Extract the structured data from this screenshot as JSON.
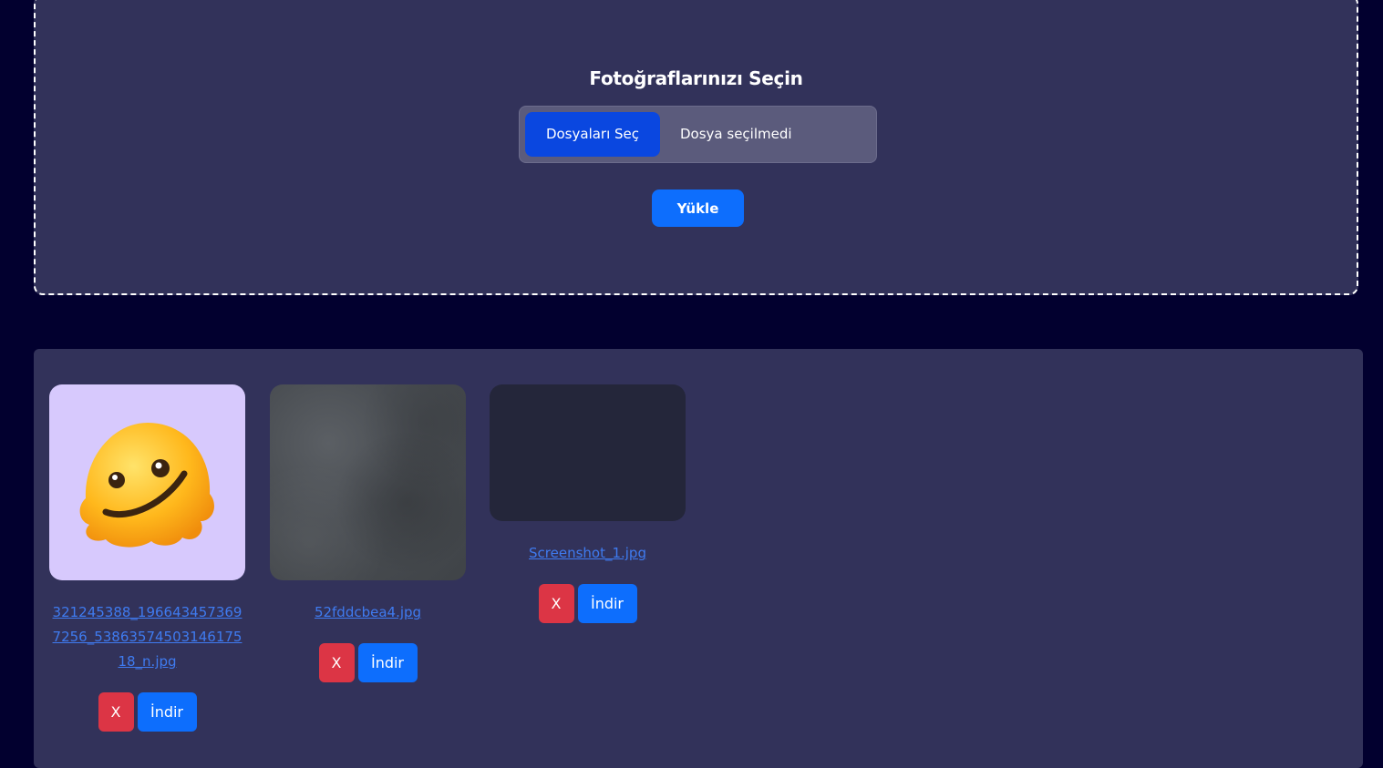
{
  "upload": {
    "title": "Fotoğraflarınızı Seçin",
    "choose_label": "Dosyaları Seç",
    "no_file_text": "Dosya seçilmedi",
    "upload_label": "Yükle"
  },
  "gallery": {
    "items": [
      {
        "filename": "321245388_1966434573697256_5386357450314617518_n.jpg",
        "thumb": "melting-face-emoji-image",
        "delete_label": "X",
        "download_label": "İndir"
      },
      {
        "filename": "52fddcbea4.jpg",
        "thumb": "gray-texture-image",
        "delete_label": "X",
        "download_label": "İndir"
      },
      {
        "filename": "Screenshot_1.jpg",
        "thumb": "dark-screenshot-image",
        "delete_label": "X",
        "download_label": "İndir"
      }
    ]
  },
  "colors": {
    "page_bg": "#02002f",
    "panel_bg": "#32325a",
    "primary": "#0d6efd",
    "choose_button": "#0a47e0",
    "danger": "#dc3545",
    "link": "#3f7bf0"
  }
}
